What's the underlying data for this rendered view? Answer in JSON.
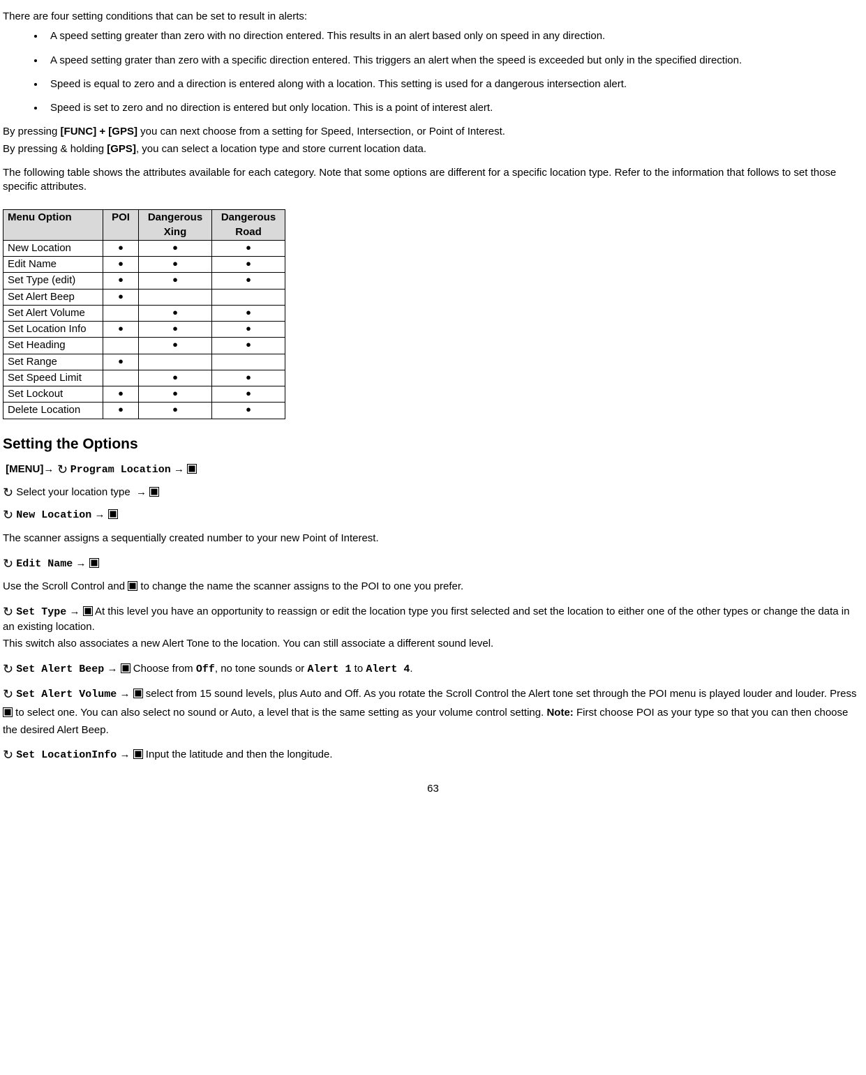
{
  "intro": "There are four setting conditions that can be set to result in alerts:",
  "bullets": [
    "A speed setting greater than zero with no direction entered. This results in an alert based only on speed in any direction.",
    "A speed setting grater than zero with a specific direction entered. This triggers an alert when the speed is exceeded but only in the specified direction.",
    "Speed is equal to zero and a direction is entered along with a location. This setting is used for a dangerous intersection alert.",
    "Speed is set to zero and no direction is entered but only location. This is a point of interest alert."
  ],
  "press1_a": "By pressing ",
  "press1_key": "[FUNC] + [GPS]",
  "press1_b": " you can next choose from a setting for Speed, Intersection, or Point of Interest.",
  "press2_a": "By pressing & holding ",
  "press2_key": "[GPS]",
  "press2_b": ", you can select a location type and store current location data.",
  "tableIntro": "The following table shows the attributes available for each category. Note that some options are different for a specific location type. Refer to the information that follows to set those specific attributes.",
  "headers": {
    "menu": "Menu Option",
    "poi": "POI",
    "xing": "Dangerous Xing",
    "road": "Dangerous Road"
  },
  "rows": [
    {
      "name": "New Location",
      "poi": "●",
      "xing": "●",
      "road": "●"
    },
    {
      "name": "Edit Name",
      "poi": "●",
      "xing": "●",
      "road": "●"
    },
    {
      "name": "Set Type (edit)",
      "poi": "●",
      "xing": "●",
      "road": "●"
    },
    {
      "name": "Set Alert Beep",
      "poi": "●",
      "xing": "",
      "road": ""
    },
    {
      "name": "Set Alert Volume",
      "poi": "",
      "xing": "●",
      "road": "●"
    },
    {
      "name": "Set Location Info",
      "poi": "●",
      "xing": "●",
      "road": "●"
    },
    {
      "name": "Set Heading",
      "poi": "",
      "xing": "●",
      "road": "●"
    },
    {
      "name": "Set Range",
      "poi": "●",
      "xing": "",
      "road": ""
    },
    {
      "name": "Set Speed Limit",
      "poi": "",
      "xing": "●",
      "road": "●"
    },
    {
      "name": "Set Lockout",
      "poi": "●",
      "xing": "●",
      "road": "●"
    },
    {
      "name": "Delete Location",
      "poi": "●",
      "xing": "●",
      "road": "●"
    }
  ],
  "section": "Setting the Options",
  "menuKey": "[MENU]",
  "arrow": "→",
  "labels": {
    "programLocation": "Program Location",
    "selectType": "Select your location type",
    "newLocation": "New Location",
    "editName": "Edit Name",
    "setType": "Set Type",
    "setAlertBeep": "Set Alert Beep",
    "setAlertVolume": "Set Alert Volume",
    "setLocationInfo": "Set LocationInfo",
    "off": "Off",
    "alert1": "Alert 1",
    "alert4": "Alert 4"
  },
  "text": {
    "newLocBody": "The scanner assigns a sequentially created number to your new Point of Interest.",
    "editNameBody_a": "Use the Scroll Control and ",
    "editNameBody_b": " to change the name the scanner assigns to the POI to one you prefer.",
    "setTypeBody1": " At this level you have an opportunity to reassign or edit the location type you first selected and set the location to either one of the other types or change the data in an existing location.",
    "setTypeBody2": "This switch also associates a new Alert Tone to the location. You can still associate a different sound level.",
    "setAlertBeepBody_a": " Choose from ",
    "setAlertBeepBody_b": ", no tone sounds or ",
    "setAlertBeepBody_c": " to ",
    "period": ".",
    "setAlertVolBody_a": " select from 15 sound levels, plus Auto and Off. As you rotate the Scroll Control the Alert tone set through the POI menu is played louder and louder. Press ",
    "setAlertVolBody_b": " to select one. You can also select no sound or Auto, a level that is the same setting as your volume control setting. ",
    "note": "Note:",
    "setAlertVolBody_c": " First choose POI as your type so that you can then choose the desired Alert Beep.",
    "setLocInfoBody": " Input the latitude and then the longitude."
  },
  "pageNumber": "63"
}
